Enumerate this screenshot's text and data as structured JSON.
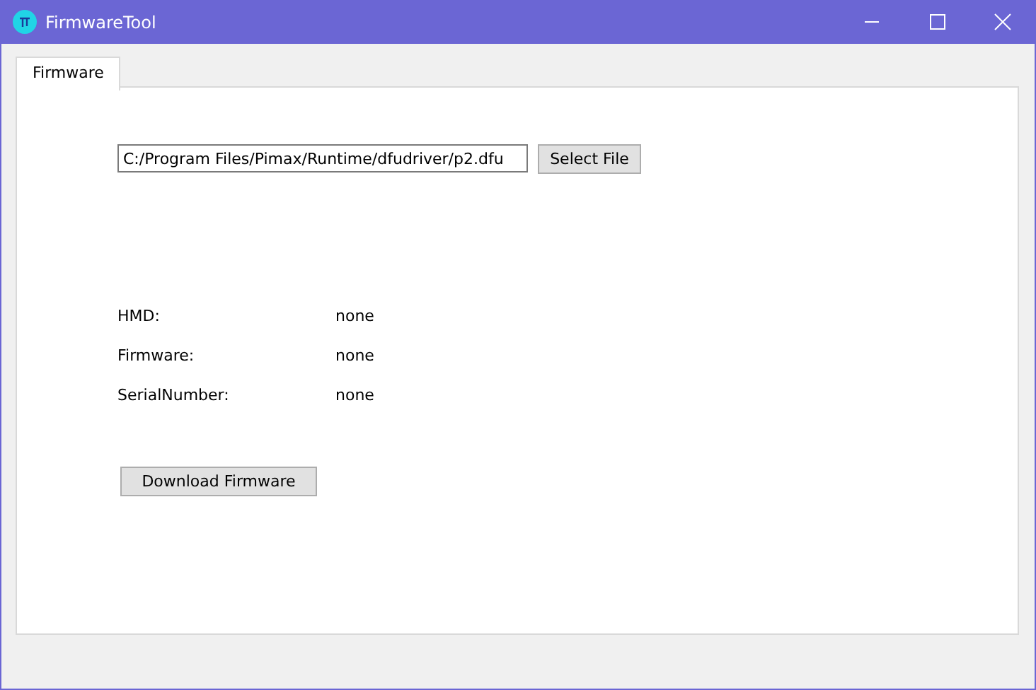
{
  "window": {
    "title": "FirmwareTool"
  },
  "tabs": [
    {
      "label": "Firmware",
      "selected": true
    }
  ],
  "file": {
    "value": "C:/Program Files/Pimax/Runtime/dfudriver/p2.dfu",
    "button": "Select File"
  },
  "info": [
    {
      "label": "HMD:",
      "value": "none"
    },
    {
      "label": "Firmware:",
      "value": "none"
    },
    {
      "label": "SerialNumber:",
      "value": "none"
    }
  ],
  "download_button": "Download Firmware"
}
